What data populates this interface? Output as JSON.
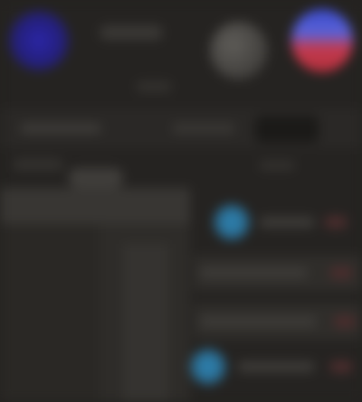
{
  "header": {
    "title": "",
    "subtitle": ""
  },
  "toolbar": {
    "label": "",
    "secondary_label": "",
    "button_label": ""
  },
  "section": {
    "label": "",
    "right_label": "",
    "tab_label": ""
  },
  "list": {
    "items": [
      {
        "label": "",
        "icon": "blue-circle-icon",
        "badge": ""
      },
      {
        "label": "",
        "icon": "",
        "badge": ""
      },
      {
        "label": "",
        "icon": "",
        "badge": ""
      },
      {
        "label": "",
        "icon": "blue-circle-icon",
        "badge": ""
      }
    ]
  },
  "colors": {
    "background": "#252321",
    "left_icon": "#2b26a8",
    "right_icon_top": "#3a49c8",
    "right_icon_bottom": "#c43a4e",
    "list_icon": "#2f87b8",
    "badge": "#4a2d2d"
  }
}
